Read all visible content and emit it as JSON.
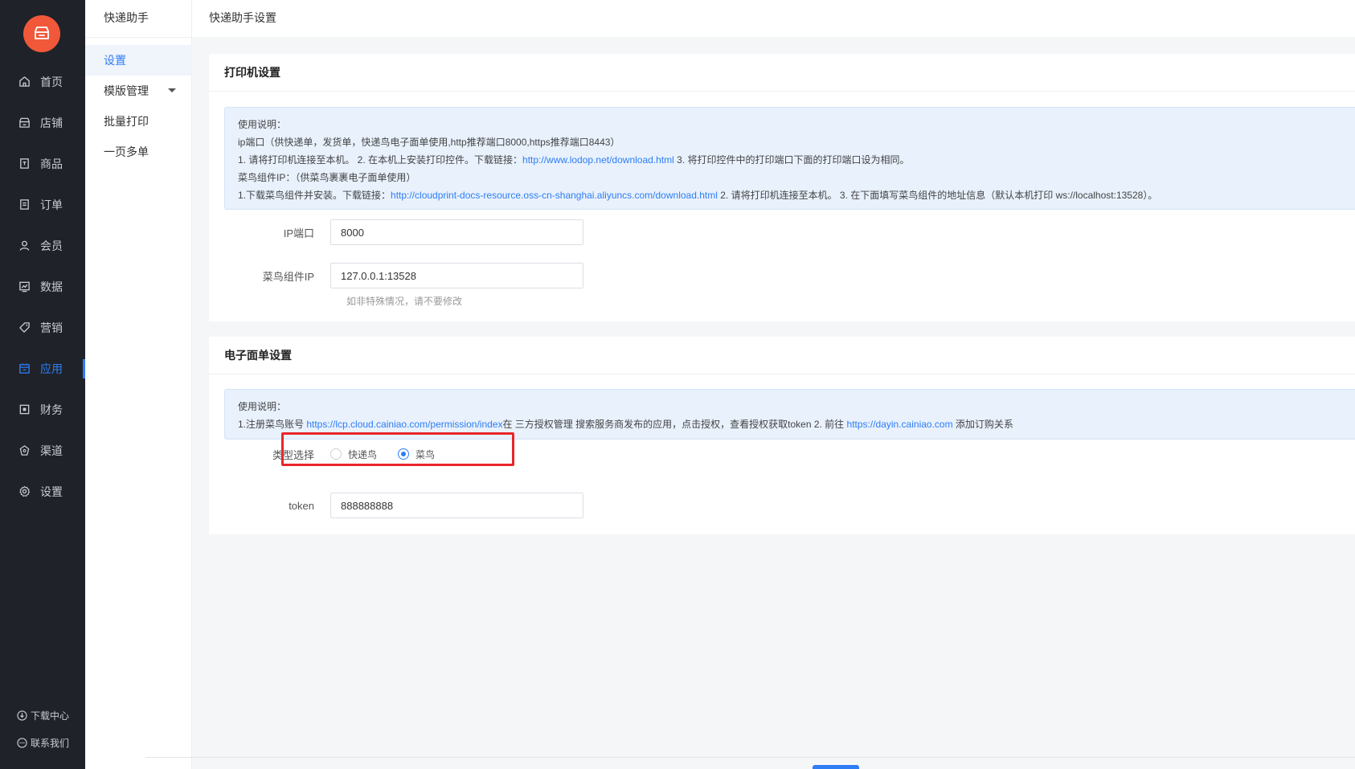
{
  "nav": {
    "items": [
      {
        "label": "首页",
        "icon": "home-icon"
      },
      {
        "label": "店铺",
        "icon": "store-icon"
      },
      {
        "label": "商品",
        "icon": "goods-icon"
      },
      {
        "label": "订单",
        "icon": "order-icon"
      },
      {
        "label": "会员",
        "icon": "member-icon"
      },
      {
        "label": "数据",
        "icon": "data-icon"
      },
      {
        "label": "营销",
        "icon": "tag-icon"
      },
      {
        "label": "应用",
        "icon": "app-icon"
      },
      {
        "label": "财务",
        "icon": "finance-icon"
      },
      {
        "label": "渠道",
        "icon": "channel-icon"
      },
      {
        "label": "设置",
        "icon": "gear-icon"
      }
    ],
    "active_index": 7,
    "download_label": "下载中心",
    "contact_label": "联系我们"
  },
  "subnav": {
    "title": "快递助手",
    "items": [
      {
        "label": "设置"
      },
      {
        "label": "模版管理"
      },
      {
        "label": "批量打印"
      },
      {
        "label": "一页多单"
      }
    ]
  },
  "page": {
    "title": "快递助手设置"
  },
  "printer": {
    "title": "打印机设置",
    "notice_heading": "使用说明：",
    "notice_line1": "ip端口（供快递单，发货单，快递鸟电子面单使用,http推荐端口8000,https推荐端口8443）",
    "notice_line2_pre": "1. 请将打印机连接至本机。 2. 在本机上安装打印控件。下载链接：",
    "notice_line2_link": "http://www.lodop.net/download.html",
    "notice_line2_post": " 3. 将打印控件中的打印端口下面的打印端口设为相同。",
    "notice_line3": "菜鸟组件IP：（供菜鸟裹裹电子面单使用）",
    "notice_line4_pre": "1.下载菜鸟组件并安装。下载链接：",
    "notice_line4_link": "http://cloudprint-docs-resource.oss-cn-shanghai.aliyuncs.com/download.html",
    "notice_line4_post": " 2. 请将打印机连接至本机。 3. 在下面填写菜鸟组件的地址信息（默认本机打印 ws://localhost:13528）。",
    "ip_label": "IP端口",
    "ip_value": "8000",
    "cainiao_label": "菜鸟组件IP",
    "cainiao_value": "127.0.0.1:13528",
    "cainiao_hint": "如非特殊情况，请不要修改"
  },
  "waybill": {
    "title": "电子面单设置",
    "notice_heading": "使用说明：",
    "notice_line1_pre": "1.注册菜鸟账号 ",
    "notice_line1_link1": "https://lcp.cloud.cainiao.com/permission/index",
    "notice_line1_mid": "在 三方授权管理 搜索服务商发布的应用，点击授权，查看授权获取token 2. 前往 ",
    "notice_line1_link2": "https://dayin.cainiao.com",
    "notice_line1_post": " 添加订购关系",
    "type_label": "类型选择",
    "type_options": [
      "快递鸟",
      "菜鸟"
    ],
    "type_selected": "菜鸟",
    "token_label": "token",
    "token_value": "888888888"
  },
  "colors": {
    "accent": "#2f7df6",
    "logo": "#f1583a",
    "highlight": "#e8262a",
    "nav_bg": "#1f2329"
  }
}
